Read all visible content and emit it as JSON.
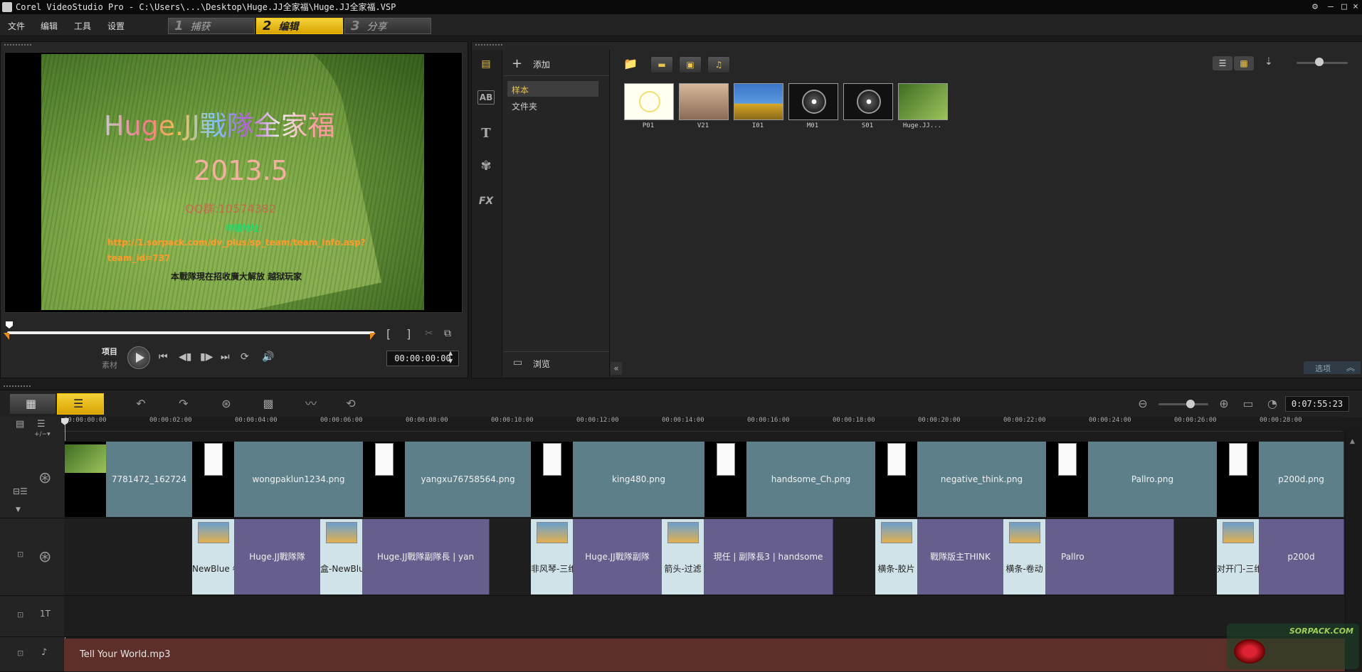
{
  "window": {
    "title": "Corel VideoStudio Pro - C:\\Users\\...\\Desktop\\Huge.JJ全家福\\Huge.JJ全家福.VSP",
    "controls": [
      "⚙",
      "–",
      "□",
      "×"
    ]
  },
  "menu": [
    "文件",
    "编辑",
    "工具",
    "设置"
  ],
  "steps": [
    {
      "num": "1",
      "label": "捕获"
    },
    {
      "num": "2",
      "label": "编辑"
    },
    {
      "num": "3",
      "label": "分享"
    }
  ],
  "preview": {
    "title_text": "Huge.JJ戰隊全家福",
    "year": "2013.5",
    "qq": "QQ群:10574382",
    "apply_label": "申請地址：",
    "url_line1": "http://1.sorpack.com/dv_plus/sp_team/team_info.asp?",
    "url_line2": "team_id=737",
    "recruit": "本戰隊現在招收廣大解放 越狱玩家"
  },
  "transport": {
    "mode_project": "项目",
    "mode_clip": "素材",
    "mark_in": "[",
    "mark_out": "]",
    "timecode": "00:00:00:00"
  },
  "library": {
    "add_label": "添加",
    "folders": [
      "样本",
      "文件夹"
    ],
    "browse_label": "浏览",
    "options_label": "选项",
    "side_tabs": [
      "▤",
      "AB",
      "T",
      "✾",
      "FX"
    ],
    "thumbs": [
      {
        "label": "P01"
      },
      {
        "label": "V21"
      },
      {
        "label": "I01"
      },
      {
        "label": "M01"
      },
      {
        "label": "S01"
      },
      {
        "label": "Huge.JJ..."
      }
    ]
  },
  "timeline": {
    "total_time": "0:07:55:23",
    "ticks": [
      "00:00:00:00",
      "00:00:02:00",
      "00:00:04:00",
      "00:00:06:00",
      "00:00:08:00",
      "00:00:10:00",
      "00:00:12:00",
      "00:00:14:00",
      "00:00:16:00",
      "00:00:18:00",
      "00:00:20:00",
      "00:00:22:00",
      "00:00:24:00",
      "00:00:26:00",
      "00:00:28:00"
    ],
    "video_clips": [
      "7781472_162724",
      "wongpaklun1234.png",
      "yangxu76758564.png",
      "king480.png",
      "handsome_Ch.png",
      "negative_think.png",
      "Pallro.png",
      "p200d.png"
    ],
    "overlay_transitions": [
      "NewBlue 卷",
      "盒-NewBlu",
      "非风琴-三维",
      "箭头-过滤",
      "横条-胶片",
      "横条-卷动",
      "对开门-三维"
    ],
    "overlay_clips": [
      "Huge.JJ戰隊隊",
      "Huge.JJ戰隊副隊長 | yan",
      "Huge.JJ戰隊副隊",
      "現任 | 副隊長3 | handsome",
      "戰隊版主THINK",
      "Pallro",
      "p200d"
    ],
    "title_track_label": "1T",
    "audio_clip": "Tell Your World.mp3"
  },
  "watermark": "SORPACK.COM"
}
